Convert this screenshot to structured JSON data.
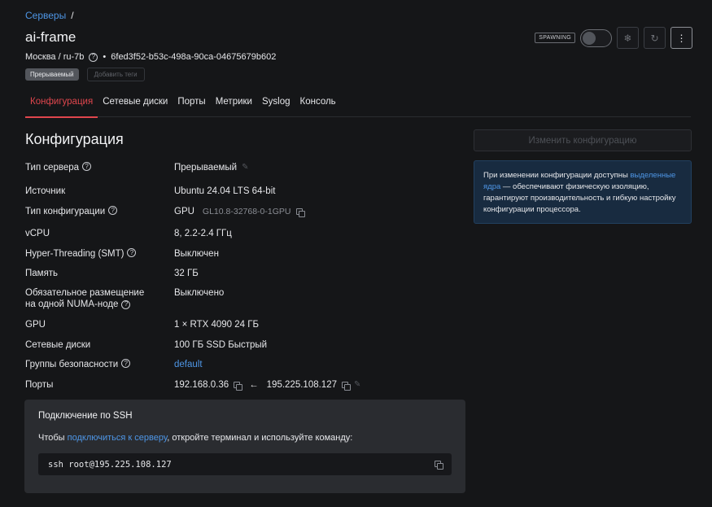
{
  "breadcrumb": {
    "link": "Серверы",
    "separator": "/"
  },
  "server": {
    "name": "ai-frame",
    "location": "Москва / ru-7b",
    "bullet": "•",
    "id": "6fed3f52-b53c-498a-90ca-04675679b602",
    "tag": "Прерываемый",
    "add_tag": "Добавить теги"
  },
  "toolbar": {
    "status": "SPAWNING",
    "status_toggle_on": false,
    "freeze_icon": "❄",
    "refresh_icon": "↻",
    "menu_icon": "⋮"
  },
  "tabs": [
    "Конфигурация",
    "Сетевые диски",
    "Порты",
    "Метрики",
    "Syslog",
    "Консоль"
  ],
  "section_title": "Конфигурация",
  "config": {
    "server_type_label": "Тип сервера",
    "server_type_value": "Прерываемый",
    "source_label": "Источник",
    "source_value": "Ubuntu 24.04 LTS 64-bit",
    "config_type_label": "Тип конфигурации",
    "config_type_value": "GPU",
    "config_type_code": "GL10.8-32768-0-1GPU",
    "vcpu_label": "vCPU",
    "vcpu_value": "8, 2.2-2.4 ГГц",
    "ht_label": "Hyper-Threading (SMT)",
    "ht_value": "Выключен",
    "memory_label": "Память",
    "memory_value": "32 ГБ",
    "numa_label_1": "Обязательное размещение",
    "numa_label_2": "на одной NUMA-ноде",
    "numa_value": "Выключено",
    "gpu_label": "GPU",
    "gpu_value": "1 × RTX 4090  24 ГБ",
    "disks_label": "Сетевые диски",
    "disks_value": "100 ГБ SSD Быстрый",
    "security_label": "Группы безопасности",
    "security_value": "default",
    "ports_label": "Порты",
    "port_private": "192.168.0.36",
    "port_arrow": "←",
    "port_public": "195.225.108.127"
  },
  "change_config_button": "Изменить конфигурацию",
  "info": {
    "text_1": "При изменении конфигурации доступны ",
    "link": "выделенные ядра",
    "text_2": " — обеспечивают физическую изоляцию, гарантируют производительность и гибкую настройку конфигурации процессора."
  },
  "ssh": {
    "title": "Подключение по SSH",
    "text_before": "Чтобы ",
    "link": "подключиться к серверу",
    "text_after": ", откройте терминал и используйте команду:",
    "command": "ssh root@195.225.108.127"
  },
  "colors": {
    "accent": "#e0464d",
    "link": "#4e96e6",
    "info_bg": "#182b40"
  }
}
